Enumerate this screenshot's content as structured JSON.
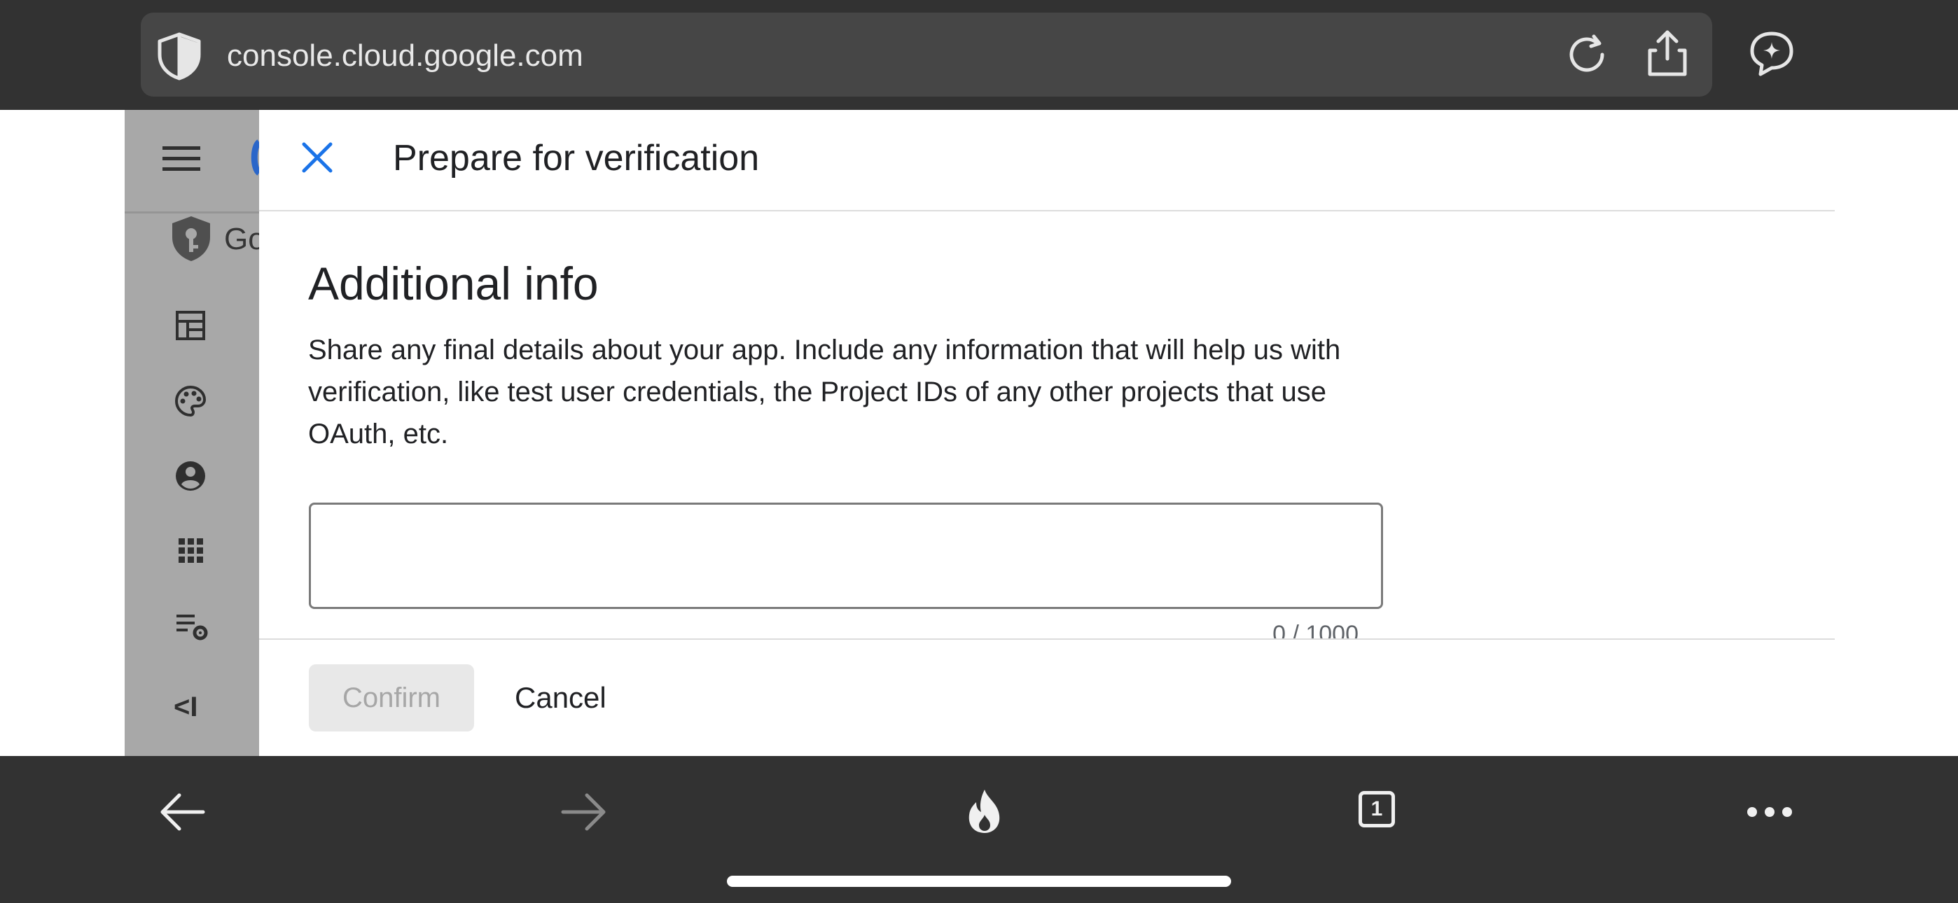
{
  "browser": {
    "url": "console.cloud.google.com",
    "tab_count": "1"
  },
  "console": {
    "product_initials": "Go"
  },
  "dialog": {
    "title": "Prepare for verification",
    "section_title": "Additional info",
    "description": "Share any final details about your app. Include any information that will help us with verification, like test user credentials, the Project IDs of any other projects that use OAuth, etc.",
    "textarea_value": "",
    "char_count": "0 / 1000",
    "confirm_label": "Confirm",
    "cancel_label": "Cancel",
    "confirm_enabled": false
  },
  "colors": {
    "accent_blue": "#1a73e8",
    "browser_chrome": "#323232"
  }
}
